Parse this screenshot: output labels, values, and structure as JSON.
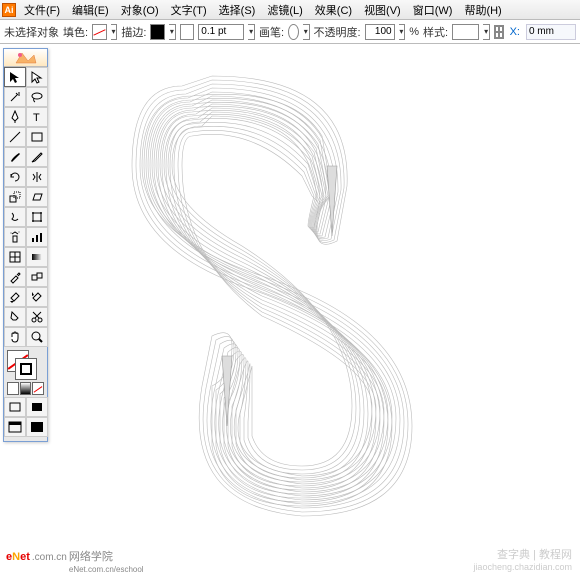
{
  "menu": {
    "items": [
      "文件(F)",
      "编辑(E)",
      "对象(O)",
      "文字(T)",
      "选择(S)",
      "滤镜(L)",
      "效果(C)",
      "视图(V)",
      "窗口(W)",
      "帮助(H)"
    ]
  },
  "optionsbar": {
    "selection_state": "未选择对象",
    "fill_label": "填色:",
    "stroke_label": "描边:",
    "stroke_weight": "0.1 pt",
    "brush_label": "画笔:",
    "opacity_label": "不透明度:",
    "opacity_value": "100",
    "opacity_pct": "%",
    "style_label": "样式:",
    "x_label": "X:",
    "x_value": "0 mm"
  },
  "watermark_left": {
    "domain_suffix": ".com.cn",
    "cn_line1": "网络学院",
    "cn_line2": "eNet.com.cn/eschool"
  },
  "watermark_right": {
    "line1": "查字典 | 教程网",
    "line2": "jiaocheng.chazidian.com"
  }
}
